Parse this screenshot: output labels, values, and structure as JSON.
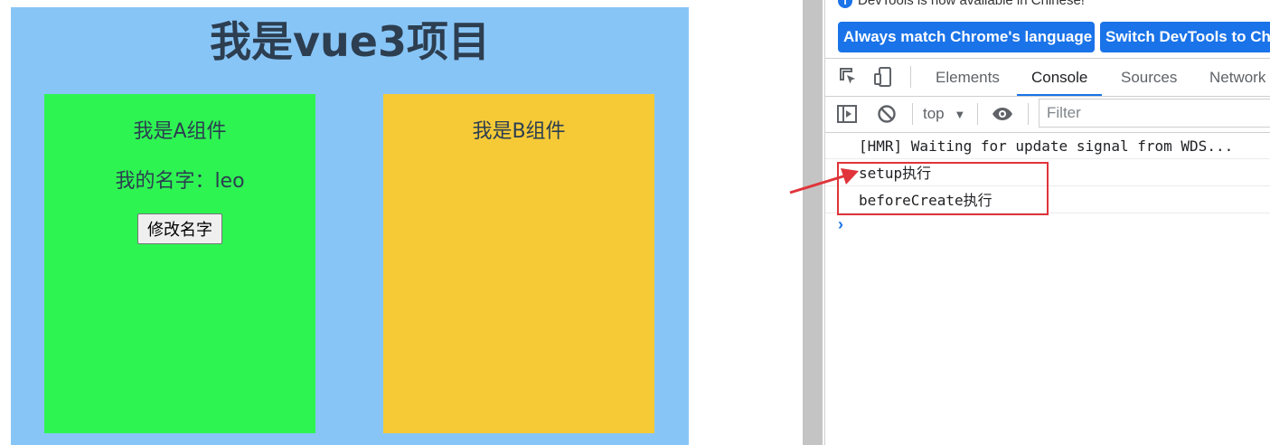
{
  "app": {
    "title": "我是vue3项目",
    "component_a": {
      "title": "我是A组件",
      "name_text": "我的名字：leo",
      "button_label": "修改名字"
    },
    "component_b": {
      "title": "我是B组件"
    }
  },
  "devtools": {
    "info_message": "DevTools is now available in Chinese!",
    "always_match_button": "Always match Chrome's language",
    "switch_button": "Switch DevTools to Chi",
    "tabs": [
      "Elements",
      "Console",
      "Sources",
      "Network"
    ],
    "active_tab": "Console",
    "context_select": "top",
    "filter_placeholder": "Filter",
    "logs": [
      "[HMR] Waiting for update signal from WDS...",
      "setup执行",
      "beforeCreate执行"
    ],
    "accent_color": "#1a73e8"
  },
  "annotation": {
    "box_color": "#e0343a"
  }
}
